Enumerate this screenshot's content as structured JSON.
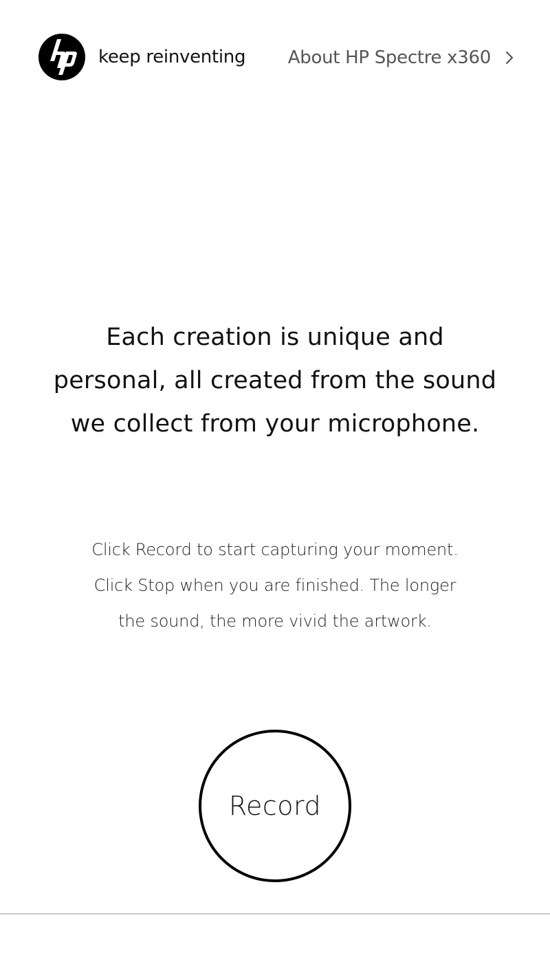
{
  "header": {
    "tagline": "keep reinventing",
    "about_link": "About HP Spectre x360",
    "logo_icon": "hp-logo-icon",
    "chevron_icon": "chevron-right-icon"
  },
  "headline": {
    "lines": [
      "Each creation is unique and",
      "personal, all created from the sound",
      "we collect from your microphone."
    ]
  },
  "instructions": {
    "lines": [
      "Click Record to start capturing your moment.",
      "Click Stop when you are finished. The longer",
      "the sound, the more vivid the artwork."
    ]
  },
  "record": {
    "label": "Record"
  },
  "colors": {
    "background": "#ffffff",
    "text": "#111111",
    "link": "#555555",
    "divider": "#c8c8c8"
  }
}
